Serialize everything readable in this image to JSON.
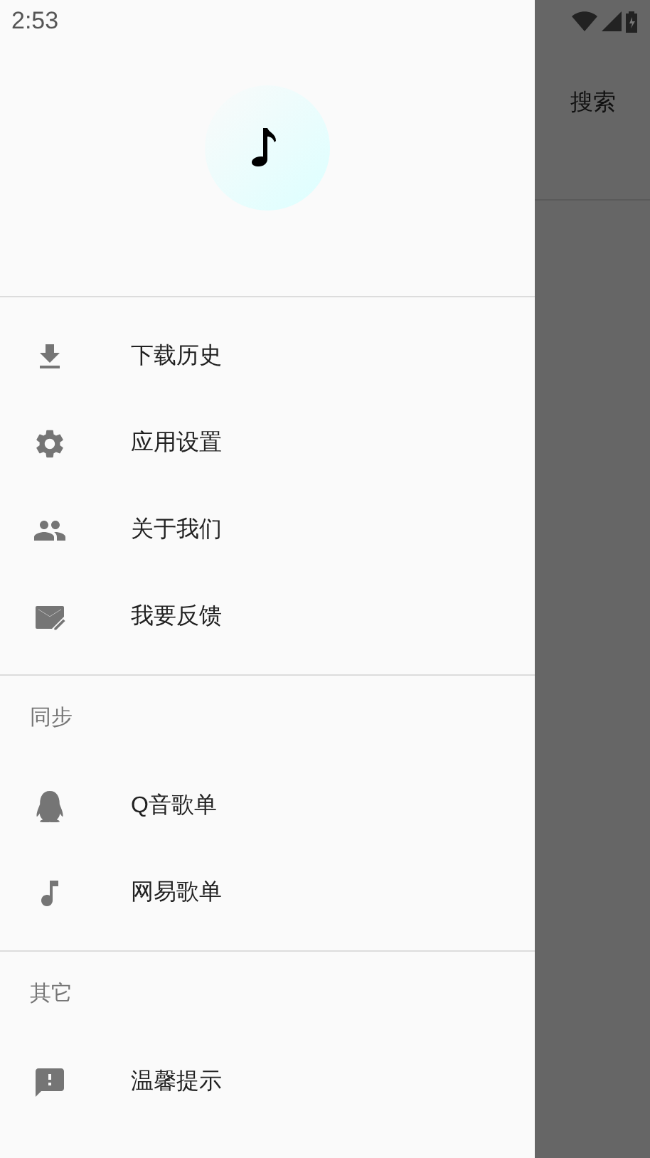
{
  "status_bar": {
    "time": "2:53"
  },
  "toolbar": {
    "action": "搜索"
  },
  "drawer": {
    "sections": [
      {
        "items": [
          {
            "label": "下载历史",
            "kind": "download"
          },
          {
            "label": "应用设置",
            "kind": "settings"
          },
          {
            "label": "关于我们",
            "kind": "people"
          },
          {
            "label": "我要反馈",
            "kind": "mail"
          }
        ]
      },
      {
        "title": "同步",
        "items": [
          {
            "label": "Q音歌单",
            "kind": "penguin"
          },
          {
            "label": "网易歌单",
            "kind": "note"
          }
        ]
      },
      {
        "title": "其它",
        "items": [
          {
            "label": "温馨提示",
            "kind": "alert"
          }
        ]
      }
    ]
  }
}
